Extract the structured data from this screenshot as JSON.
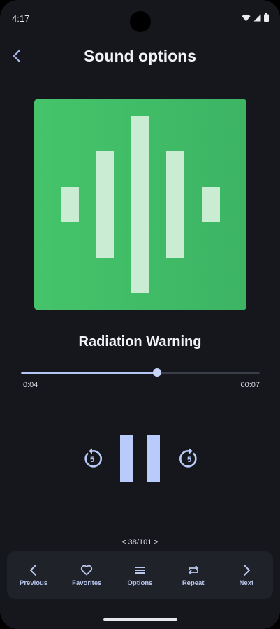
{
  "status_bar": {
    "time": "4:17"
  },
  "header": {
    "title": "Sound options"
  },
  "colors": {
    "artwork": "#45c46a",
    "accent": "#b9cbfb",
    "background": "#15171c"
  },
  "track": {
    "title": "Radiation Warning"
  },
  "playback": {
    "elapsed": "0:04",
    "total": "00:07",
    "progress_fraction": 0.57,
    "replay_seconds": "5",
    "forward_seconds": "5"
  },
  "pager": {
    "text": "< 38/101 >"
  },
  "nav": {
    "items": [
      {
        "label": "Previous",
        "icon": "chevron-left-icon"
      },
      {
        "label": "Favorites",
        "icon": "heart-icon"
      },
      {
        "label": "Options",
        "icon": "menu-icon"
      },
      {
        "label": "Repeat",
        "icon": "repeat-icon"
      },
      {
        "label": "Next",
        "icon": "chevron-right-icon"
      }
    ]
  }
}
